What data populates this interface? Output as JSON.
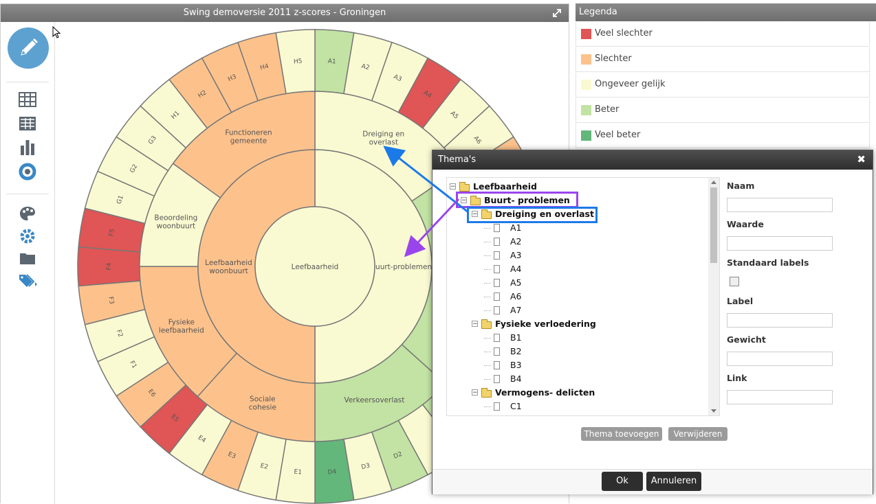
{
  "chart_window": {
    "title": "Swing demoversie 2011 z-scores - Groningen"
  },
  "legend": {
    "title": "Legenda",
    "items": [
      {
        "label": "Veel slechter",
        "color": "#e05555"
      },
      {
        "label": "Slechter",
        "color": "#fdc28c"
      },
      {
        "label": "Ongeveer gelijk",
        "color": "#fafad2"
      },
      {
        "label": "Beter",
        "color": "#c2e3a3"
      },
      {
        "label": "Veel beter",
        "color": "#63b77a"
      }
    ]
  },
  "toolbar": {
    "icons": [
      "pencil-icon",
      "table-icon",
      "grid-table-icon",
      "bar-chart-icon",
      "donut-chart-icon",
      "palette-icon",
      "settings-icon",
      "folder-icon",
      "tags-icon"
    ]
  },
  "chart_data": {
    "type": "sunburst",
    "colors": {
      "VS": "#e05555",
      "S": "#fdc28c",
      "G": "#fafad2",
      "B": "#c2e3a3",
      "VB": "#63b77a"
    },
    "center": {
      "label": "Leefbaarheid",
      "color": "G"
    },
    "ring1": [
      {
        "label": "Buurt-problemen",
        "start": 0,
        "end": 180,
        "color": "G"
      },
      {
        "label": "Leefbaarheid woonbuurt",
        "start": 180,
        "end": 360,
        "color": "S"
      }
    ],
    "ring2": [
      {
        "label": "Dreiging en overlast",
        "start": 0,
        "end": 56,
        "color": "G"
      },
      {
        "label": "Fysieke verloedering",
        "start": 56,
        "end": 88,
        "color": "B"
      },
      {
        "label": "",
        "start": 88,
        "end": 132,
        "color": "B"
      },
      {
        "label": "Verkeersoverlast",
        "start": 132,
        "end": 180,
        "color": "B"
      },
      {
        "label": "Sociale cohesie",
        "start": 180,
        "end": 222,
        "color": "S"
      },
      {
        "label": "Fysieke leefbaarheid",
        "start": 222,
        "end": 270,
        "color": "S"
      },
      {
        "label": "Beoordeling woonbuurt",
        "start": 270,
        "end": 306,
        "color": "G"
      },
      {
        "label": "Functioneren gemeente",
        "start": 306,
        "end": 360,
        "color": "S"
      }
    ],
    "ring3": [
      {
        "label": "A1",
        "color": "B"
      },
      {
        "label": "A2",
        "color": "G"
      },
      {
        "label": "A3",
        "color": "G"
      },
      {
        "label": "A4",
        "color": "VS"
      },
      {
        "label": "A5",
        "color": "G"
      },
      {
        "label": "A6",
        "color": "G"
      },
      {
        "label": "A7",
        "color": "S"
      },
      {
        "label": "B1",
        "color": "G"
      },
      {
        "label": "",
        "color": "G"
      },
      {
        "label": "",
        "color": "B"
      },
      {
        "label": "",
        "color": "B"
      },
      {
        "label": "",
        "color": "G"
      },
      {
        "label": "",
        "color": "B"
      },
      {
        "label": "",
        "color": "G"
      },
      {
        "label": "",
        "color": "B"
      },
      {
        "label": "",
        "color": "G"
      },
      {
        "label": "D2",
        "color": "B"
      },
      {
        "label": "D3",
        "color": "G"
      },
      {
        "label": "D4",
        "color": "VB"
      },
      {
        "label": "E1",
        "color": "G"
      },
      {
        "label": "E2",
        "color": "G"
      },
      {
        "label": "E3",
        "color": "S"
      },
      {
        "label": "E4",
        "color": "G"
      },
      {
        "label": "E5",
        "color": "VS"
      },
      {
        "label": "E6",
        "color": "S"
      },
      {
        "label": "F1",
        "color": "G"
      },
      {
        "label": "F2",
        "color": "G"
      },
      {
        "label": "F3",
        "color": "S"
      },
      {
        "label": "F4",
        "color": "VS"
      },
      {
        "label": "F5",
        "color": "VS"
      },
      {
        "label": "G1",
        "color": "G"
      },
      {
        "label": "G2",
        "color": "G"
      },
      {
        "label": "G3",
        "color": "G"
      },
      {
        "label": "H1",
        "color": "G"
      },
      {
        "label": "H2",
        "color": "S"
      },
      {
        "label": "H3",
        "color": "S"
      },
      {
        "label": "H4",
        "color": "S"
      },
      {
        "label": "H5",
        "color": "G"
      }
    ]
  },
  "dialog": {
    "title": "Thema's",
    "close_symbol": "✖",
    "tree": [
      {
        "label": "Leefbaarheid",
        "type": "folder",
        "level": 0
      },
      {
        "label": "Buurt- problemen",
        "type": "folder",
        "level": 1
      },
      {
        "label": "Dreiging en overlast",
        "type": "folder",
        "level": 2
      },
      {
        "label": "A1",
        "type": "leaf",
        "level": 3
      },
      {
        "label": "A2",
        "type": "leaf",
        "level": 3
      },
      {
        "label": "A3",
        "type": "leaf",
        "level": 3
      },
      {
        "label": "A4",
        "type": "leaf",
        "level": 3
      },
      {
        "label": "A5",
        "type": "leaf",
        "level": 3
      },
      {
        "label": "A6",
        "type": "leaf",
        "level": 3
      },
      {
        "label": "A7",
        "type": "leaf",
        "level": 3
      },
      {
        "label": "Fysieke verloedering",
        "type": "folder",
        "level": 2
      },
      {
        "label": "B1",
        "type": "leaf",
        "level": 3
      },
      {
        "label": "B2",
        "type": "leaf",
        "level": 3
      },
      {
        "label": "B3",
        "type": "leaf",
        "level": 3
      },
      {
        "label": "B4",
        "type": "leaf",
        "level": 3
      },
      {
        "label": "Vermogens- delicten",
        "type": "folder",
        "level": 2
      },
      {
        "label": "C1",
        "type": "leaf",
        "level": 3
      },
      {
        "label": "C2",
        "type": "leaf",
        "level": 3
      }
    ],
    "fields": {
      "naam": "Naam",
      "waarde": "Waarde",
      "standaard_labels": "Standaard labels",
      "label": "Label",
      "gewicht": "Gewicht",
      "link": "Link"
    },
    "buttons": {
      "add": "Thema toevoegen",
      "remove": "Verwijderen",
      "ok": "Ok",
      "cancel": "Annuleren"
    },
    "annotation_colors": {
      "purple": "#9a45ec",
      "blue": "#1c7ae8"
    }
  }
}
